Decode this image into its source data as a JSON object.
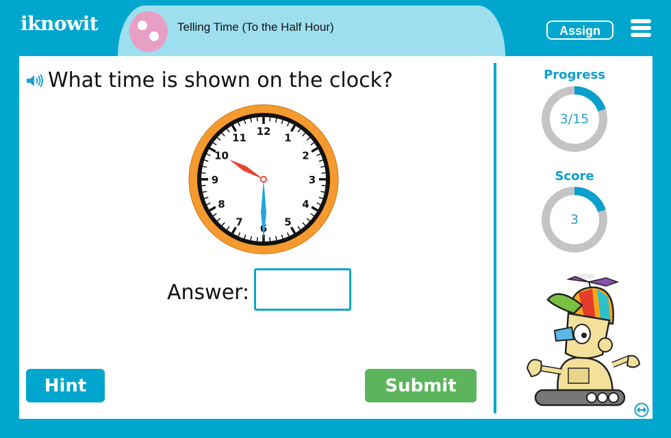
{
  "header": {
    "logo": "iknowit",
    "topic_title": "Telling Time (To the Half Hour)",
    "assign_label": "Assign",
    "menu_icon": "hamburger-menu-icon"
  },
  "question": {
    "speaker_icon": "speaker-icon",
    "text": "What time is shown on the clock?"
  },
  "clock": {
    "hour_hand_color": "#e8442e",
    "minute_hand_color": "#22a6e0",
    "rim_color": "#f59a2e",
    "shown_time": {
      "hour": 10,
      "minute": 30
    },
    "numbers": [
      "12",
      "1",
      "2",
      "3",
      "4",
      "5",
      "6",
      "7",
      "8",
      "9",
      "10",
      "11"
    ]
  },
  "answer": {
    "label": "Answer:",
    "value": "",
    "placeholder": ""
  },
  "buttons": {
    "hint": "Hint",
    "submit": "Submit"
  },
  "sidebar": {
    "progress": {
      "label": "Progress",
      "text": "3/15",
      "current": 3,
      "total": 15
    },
    "score": {
      "label": "Score",
      "text": "3",
      "fraction": 0.2
    },
    "mascot_icon": "robot-mascot-icon",
    "expand_icon": "expand-arrows-icon"
  },
  "colors": {
    "brand_blue": "#00a6cd",
    "light_blue": "#9edfef",
    "topic_pink": "#e79fc6",
    "submit_green": "#5cb55c",
    "ring_gray": "#c4c4c4"
  }
}
